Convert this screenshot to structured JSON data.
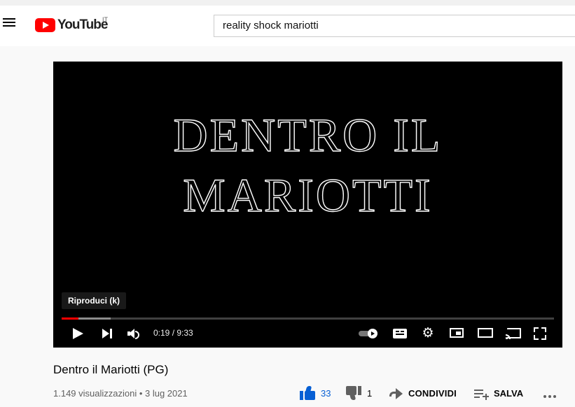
{
  "header": {
    "logo_text": "YouTube",
    "country_code": "IT",
    "search_value": "reality shock mariotti"
  },
  "player": {
    "title_line1": "DENTRO IL",
    "title_line2": "MARIOTTI",
    "tooltip": "Riproduci (k)",
    "time": "0:19 / 9:33",
    "progress_played_fraction": 0.034,
    "progress_buffered_fraction": 0.1
  },
  "video": {
    "title": "Dentro il Mariotti (PG)",
    "meta": "1.149 visualizzazioni • 3 lug 2021"
  },
  "actions": {
    "like_count": "33",
    "dislike_count": "1",
    "share_label": "CONDIVIDI",
    "save_label": "SALVA"
  },
  "colors": {
    "accent": "#ff0000",
    "like_blue": "#065fd4"
  }
}
